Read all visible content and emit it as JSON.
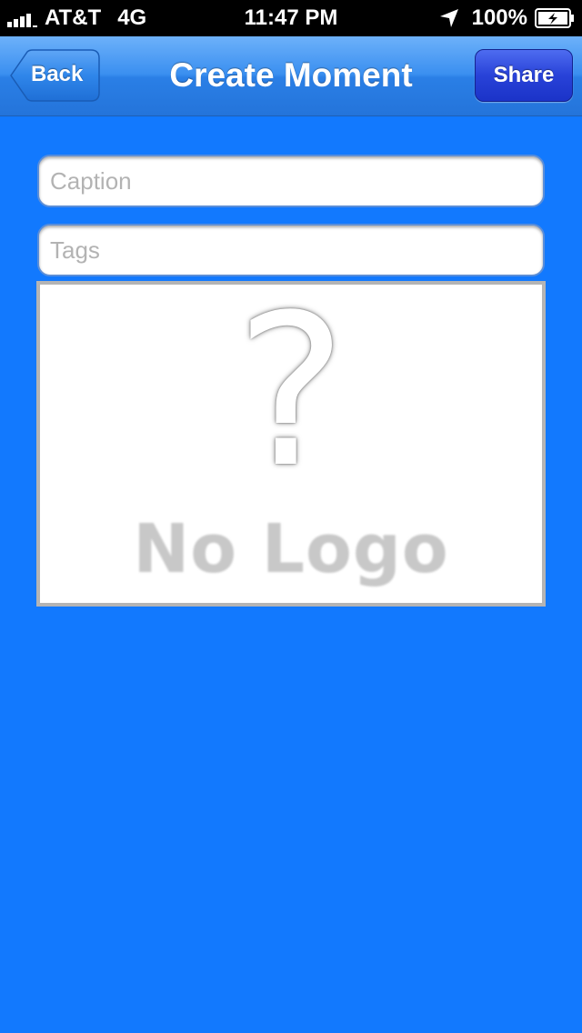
{
  "status_bar": {
    "carrier": "AT&T",
    "network": "4G",
    "time": "11:47 PM",
    "battery": "100%",
    "icons": [
      "signal-icon",
      "location-icon",
      "battery-icon"
    ]
  },
  "nav_bar": {
    "title": "Create Moment",
    "back_label": "Back",
    "share_label": "Share"
  },
  "form": {
    "caption": {
      "placeholder": "Caption",
      "value": ""
    },
    "tags": {
      "placeholder": "Tags",
      "value": ""
    }
  },
  "logo_placeholder": {
    "symbol": "?",
    "text": "No Logo"
  },
  "colors": {
    "background": "#1279fe",
    "nav_bar": "#3a8ff0",
    "share_button": "#2842d8"
  }
}
